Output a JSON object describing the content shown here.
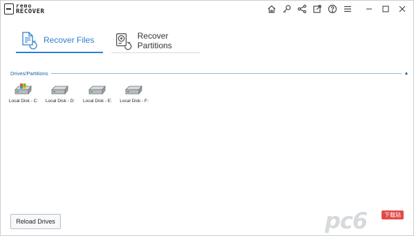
{
  "app": {
    "logo_top": "remo",
    "logo_bottom": "RECOVER"
  },
  "title_tools": [
    {
      "name": "home-icon"
    },
    {
      "name": "key-icon"
    },
    {
      "name": "share-icon"
    },
    {
      "name": "export-icon"
    },
    {
      "name": "help-icon"
    },
    {
      "name": "menu-icon"
    }
  ],
  "window_controls": [
    "minimize-icon",
    "maximize-icon",
    "close-icon"
  ],
  "tabs": [
    {
      "label": "Recover Files",
      "active": true
    },
    {
      "label": "Recover Partitions",
      "active": false
    }
  ],
  "section": {
    "title": "Drives/Partitions",
    "collapse_glyph": "▲"
  },
  "drives": [
    {
      "label": "Local Disk - C:",
      "type": "system"
    },
    {
      "label": "Local Disk - D:",
      "type": "disk"
    },
    {
      "label": "Local Disk - E:",
      "type": "disk"
    },
    {
      "label": "Local Disk - F:",
      "type": "disk"
    }
  ],
  "footer": {
    "reload_label": "Reload Drives"
  },
  "watermark": {
    "text": "pc6",
    "badge": "下载站"
  },
  "colors": {
    "accent": "#2b7fd0",
    "section_title": "#1a5fa8",
    "watermark_badge": "#dd2a2a"
  }
}
